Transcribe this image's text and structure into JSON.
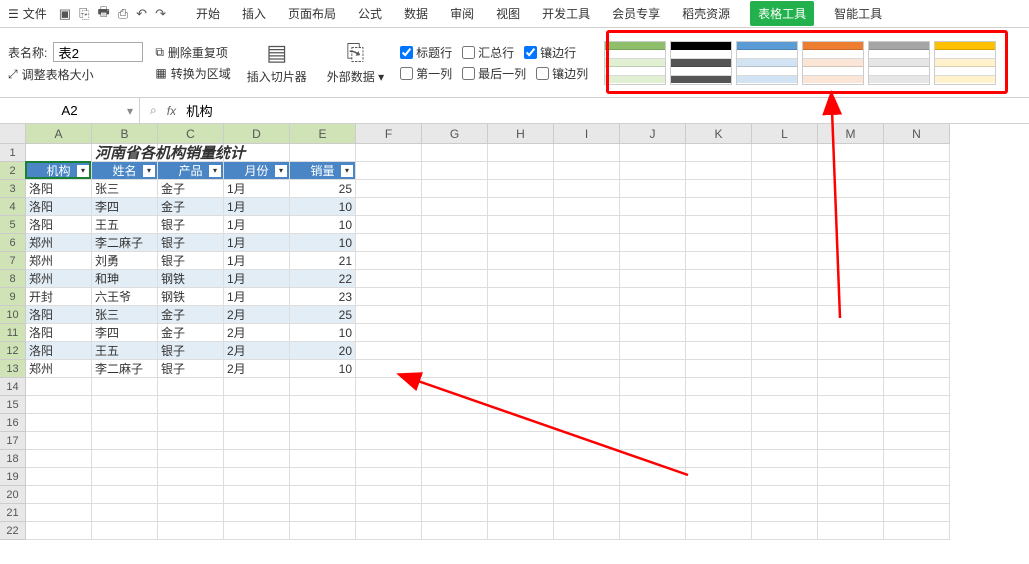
{
  "menubar": {
    "file": "文件",
    "tabs": [
      "开始",
      "插入",
      "页面布局",
      "公式",
      "数据",
      "审阅",
      "视图",
      "开发工具",
      "会员专享",
      "稻壳资源",
      "表格工具",
      "智能工具"
    ]
  },
  "ribbon": {
    "tname_label": "表名称:",
    "tname_value": "表2",
    "resize": "调整表格大小",
    "dedup": "删除重复项",
    "torange": "转换为区域",
    "slicer": "插入切片器",
    "extdata": "外部数据",
    "cb_header": "标题行",
    "cb_total": "汇总行",
    "cb_bandrow": "镶边行",
    "cb_firstcol": "第一列",
    "cb_lastcol": "最后一列",
    "cb_bandcol": "镶边列"
  },
  "formula": {
    "namebox": "A2",
    "fx": "fx",
    "content": "机构"
  },
  "columns": [
    "A",
    "B",
    "C",
    "D",
    "E",
    "F",
    "G",
    "H",
    "I",
    "J",
    "K",
    "L",
    "M",
    "N"
  ],
  "title": "河南省各机构销量统计",
  "headers": [
    "机构",
    "姓名",
    "产品",
    "月份",
    "销量"
  ],
  "rows": [
    {
      "a": "洛阳",
      "b": "张三",
      "c": "金子",
      "d": "1月",
      "e": "25"
    },
    {
      "a": "洛阳",
      "b": "李四",
      "c": "金子",
      "d": "1月",
      "e": "10"
    },
    {
      "a": "洛阳",
      "b": "王五",
      "c": "银子",
      "d": "1月",
      "e": "10"
    },
    {
      "a": "郑州",
      "b": "李二麻子",
      "c": "银子",
      "d": "1月",
      "e": "10"
    },
    {
      "a": "郑州",
      "b": "刘勇",
      "c": "银子",
      "d": "1月",
      "e": "21"
    },
    {
      "a": "郑州",
      "b": "和珅",
      "c": "钢铁",
      "d": "1月",
      "e": "22"
    },
    {
      "a": "开封",
      "b": "六王爷",
      "c": "钢铁",
      "d": "1月",
      "e": "23"
    },
    {
      "a": "洛阳",
      "b": "张三",
      "c": "金子",
      "d": "2月",
      "e": "25"
    },
    {
      "a": "洛阳",
      "b": "李四",
      "c": "金子",
      "d": "2月",
      "e": "10"
    },
    {
      "a": "洛阳",
      "b": "王五",
      "c": "银子",
      "d": "2月",
      "e": "20"
    },
    {
      "a": "郑州",
      "b": "李二麻子",
      "c": "银子",
      "d": "2月",
      "e": "10"
    }
  ],
  "style_colors": [
    {
      "h": "#8fbf6b",
      "b": "#e1efd3"
    },
    {
      "h": "#000000",
      "b": "#555555"
    },
    {
      "h": "#5b9bd5",
      "b": "#d2e3f3"
    },
    {
      "h": "#ed7d31",
      "b": "#fbe5d6"
    },
    {
      "h": "#a5a5a5",
      "b": "#e7e6e6"
    },
    {
      "h": "#ffc000",
      "b": "#fff2cc"
    }
  ]
}
